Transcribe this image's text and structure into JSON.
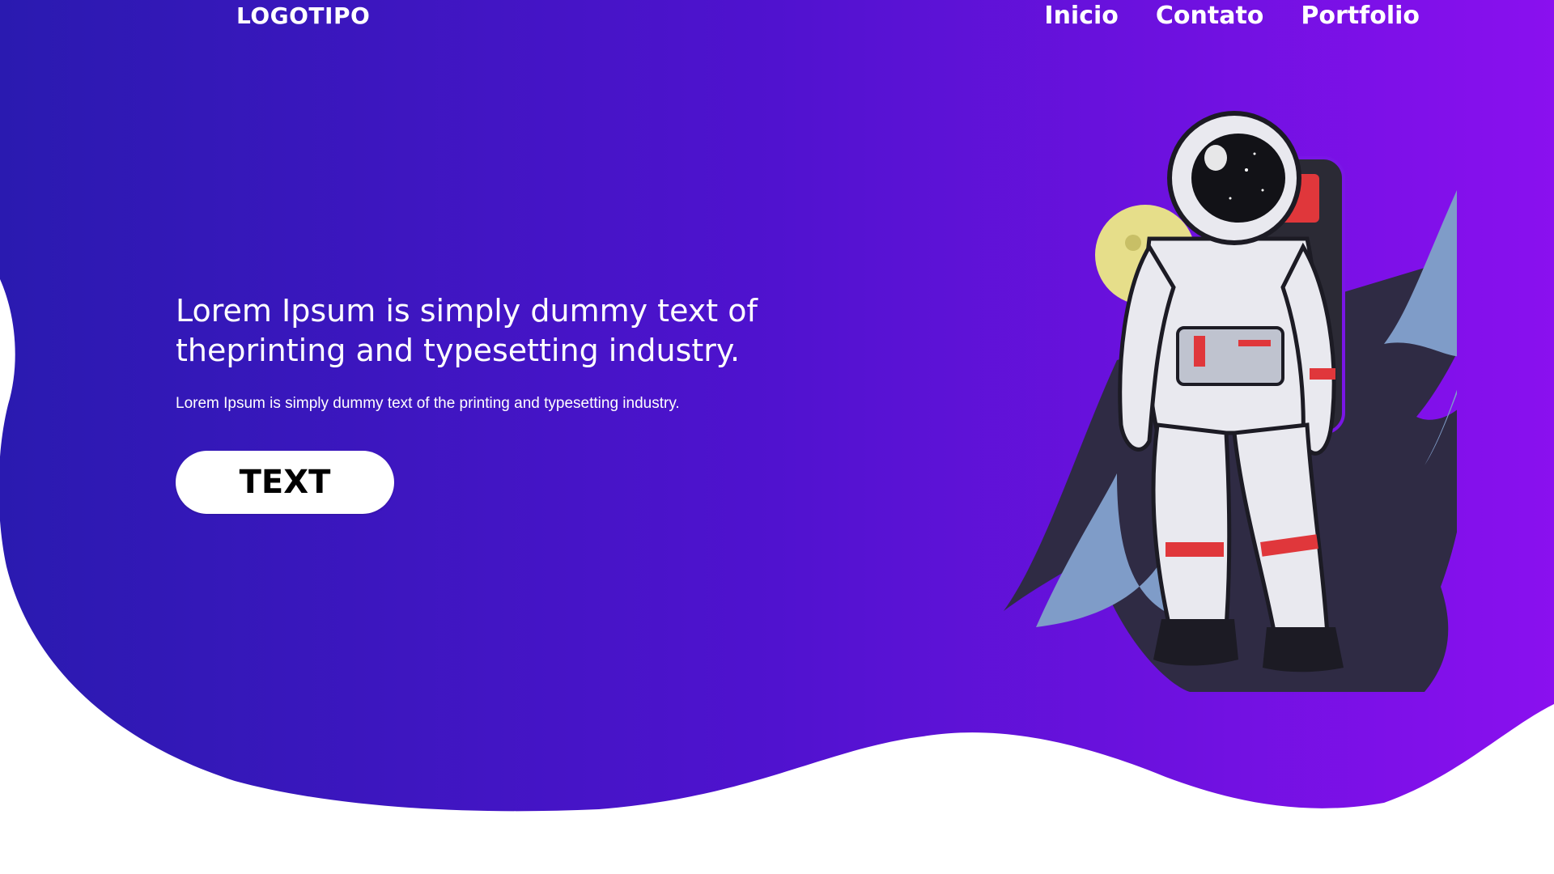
{
  "header": {
    "logo_text": "LOGOTIPO",
    "nav": [
      {
        "label": "Inicio"
      },
      {
        "label": "Contato"
      },
      {
        "label": "Portfolio"
      }
    ]
  },
  "hero": {
    "title": "Lorem Ipsum is simply dummy text of theprinting and typesetting industry.",
    "subtitle": "Lorem Ipsum is simply dummy text of the printing and typesetting industry.",
    "button_label": "TEXT",
    "illustration": "astronaut-illustration"
  },
  "colors": {
    "gradient_start": "#2a1ab0",
    "gradient_end": "#8a10ef",
    "text": "#ffffff",
    "button_bg": "#ffffff",
    "button_text": "#000000"
  }
}
